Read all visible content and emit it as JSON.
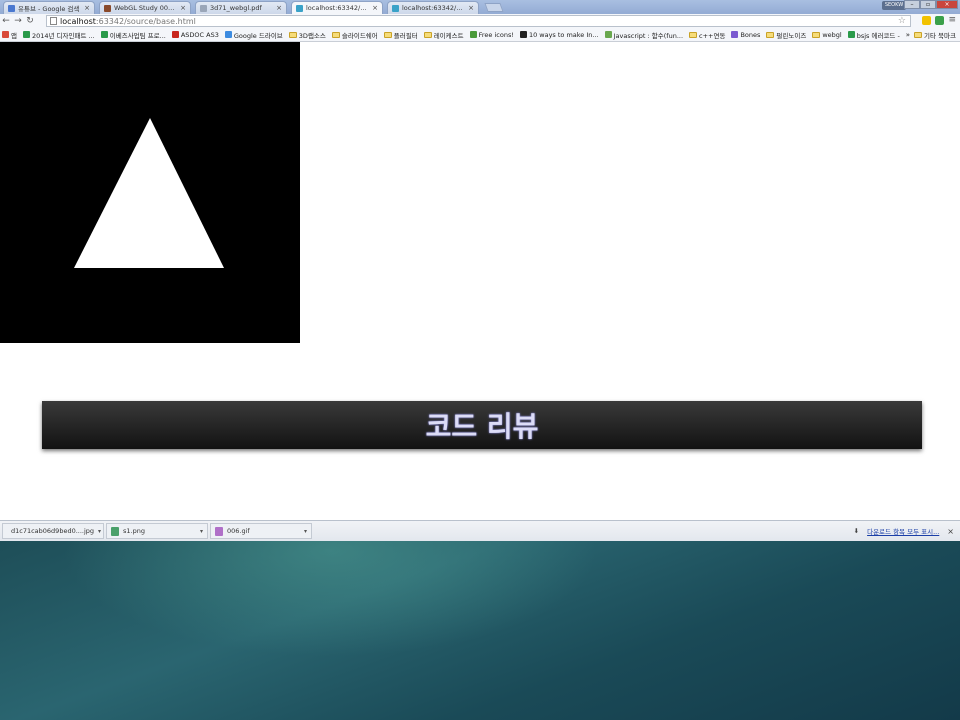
{
  "browser": {
    "tabs": [
      {
        "title": "유튜브 - Google 검색",
        "favicon_color": "#4a78d0",
        "active": false
      },
      {
        "title": "WebGL Study 007 – Tran",
        "favicon_color": "#8a4a2a",
        "active": false
      },
      {
        "title": "3d71_webgl.pdf",
        "favicon_color": "#9aa6b8",
        "active": false
      },
      {
        "title": "localhost:63342/source/t",
        "favicon_color": "#3aa2c8",
        "active": true
      },
      {
        "title": "localhost:63342/source/t",
        "favicon_color": "#3aa2c8",
        "active": false
      }
    ],
    "tab_close_glyph": "×",
    "user_label": "SEOKW",
    "address": {
      "host": "localhost",
      "path": ":63342/source/base.html"
    },
    "bookmarks": [
      {
        "label": "앱",
        "icon": "apps-icon",
        "color": "#d94a3a"
      },
      {
        "label": "2014년 디자인패트 ...",
        "icon": "sheet-icon",
        "color": "#2a9a4a"
      },
      {
        "label": "이베즈사업팀 프로...",
        "icon": "sheet-icon",
        "color": "#2a9a4a"
      },
      {
        "label": "ASDOC AS3",
        "icon": "adobe-icon",
        "color": "#c8261e"
      },
      {
        "label": "Google 드라이브",
        "icon": "drive-icon",
        "color": "#3c8be0"
      },
      {
        "label": "3D랩소스",
        "icon": "folder-icon",
        "color": "#f6dc7a"
      },
      {
        "label": "슬라이드쉐어",
        "icon": "folder-icon",
        "color": "#f6dc7a"
      },
      {
        "label": "플러필터",
        "icon": "folder-icon",
        "color": "#f6dc7a"
      },
      {
        "label": "레이케스트",
        "icon": "folder-icon",
        "color": "#f6dc7a"
      },
      {
        "label": "Free icons!",
        "icon": "leaf-icon",
        "color": "#4a9a3a"
      },
      {
        "label": "10 ways to make In...",
        "icon": "paw-icon",
        "color": "#222222"
      },
      {
        "label": "Javascript : 함수(fun...",
        "icon": "check-icon",
        "color": "#6aa84f"
      },
      {
        "label": "c++연동",
        "icon": "folder-icon",
        "color": "#f6dc7a"
      },
      {
        "label": "Bones",
        "icon": "bones-icon",
        "color": "#7a5ad0"
      },
      {
        "label": "펄린노이즈",
        "icon": "folder-icon",
        "color": "#f6dc7a"
      },
      {
        "label": "webgl",
        "icon": "folder-icon",
        "color": "#f6dc7a"
      },
      {
        "label": "bsjs 에러코드 - Goo...",
        "icon": "sheet-icon",
        "color": "#2a9a4a"
      }
    ],
    "bookmarks_more": "»",
    "other_bookmarks": "기타 북마크"
  },
  "page": {
    "heading": "코드 리뷰",
    "canvas_bg": "#000000",
    "triangle_color": "#ffffff"
  },
  "downloads": {
    "items": [
      {
        "name": "d1c71cab06d9bed0....jpg",
        "icon": "image-file-icon",
        "color": "#e08a2a"
      },
      {
        "name": "s1.png",
        "icon": "image-file-icon",
        "color": "#4aa06a"
      },
      {
        "name": "006.gif",
        "icon": "image-file-icon",
        "color": "#b070c8"
      }
    ],
    "caret": "▾",
    "show_all": "다운로드 항목 모두 표시...",
    "close": "×"
  }
}
